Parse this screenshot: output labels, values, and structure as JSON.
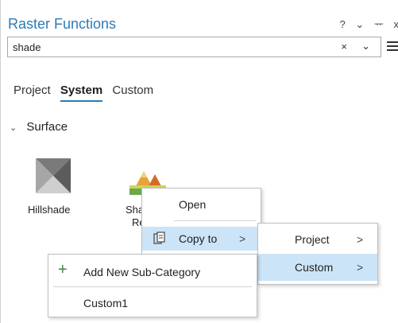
{
  "pane": {
    "title": "Raster Functions",
    "controls": {
      "help": "?",
      "options": "⌄",
      "pin": "ᅲ",
      "close": "x"
    }
  },
  "search": {
    "value": "shade",
    "clear": "×",
    "dropdown": "⌄"
  },
  "tabs": [
    {
      "label": "Project",
      "active": false
    },
    {
      "label": "System",
      "active": true
    },
    {
      "label": "Custom",
      "active": false
    }
  ],
  "section": {
    "label": "Surface",
    "chevron": "⌄"
  },
  "tiles": [
    {
      "label": "Hillshade",
      "icon": "hillshade-icon"
    },
    {
      "label_line1": "Sha",
      "label_line2": "Re",
      "icon": "shaded-relief-icon"
    }
  ],
  "context_menu": {
    "open_label": "Open",
    "copy_to_label": "Copy to",
    "copy_to_arrow": ">"
  },
  "submenu": {
    "items": [
      {
        "label": "Project",
        "arrow": ">"
      },
      {
        "label": "Custom",
        "arrow": ">"
      }
    ]
  },
  "subsubmenu": {
    "add_label": "Add New Sub-Category",
    "add_icon": "+",
    "custom1_label": "Custom1"
  },
  "colors": {
    "accent": "#2c7bb6",
    "highlight": "#cce4f7",
    "add_green": "#3a8a3a"
  }
}
